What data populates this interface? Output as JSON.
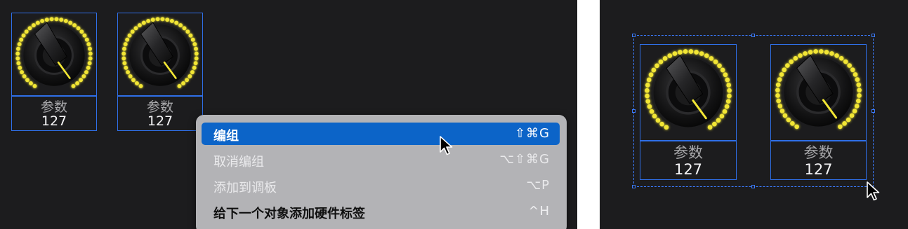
{
  "left_panel": {
    "knobs": [
      {
        "label": "参数",
        "value": "127"
      },
      {
        "label": "参数",
        "value": "127"
      }
    ]
  },
  "context_menu": {
    "items": [
      {
        "label": "编组",
        "shortcut": "⇧⌘G",
        "state": "highlighted"
      },
      {
        "label": "取消编组",
        "shortcut": "⌥⇧⌘G",
        "state": "disabled"
      },
      {
        "label": "添加到调板",
        "shortcut": "⌥P",
        "state": "disabled"
      },
      {
        "label": "给下一个对象添加硬件标签",
        "shortcut": "^H",
        "state": "enabled"
      }
    ]
  },
  "right_panel": {
    "knobs": [
      {
        "label": "参数",
        "value": "127"
      },
      {
        "label": "参数",
        "value": "127"
      }
    ]
  },
  "colors": {
    "background": "#1c1c1e",
    "led": "#f2e634",
    "selection": "#2f6fe8",
    "menu_background": "#b3b3b6",
    "menu_highlight": "#0c64c8"
  },
  "icons": [
    "knob-dial",
    "pointer-cursor",
    "shift-key",
    "command-key",
    "option-key",
    "control-key"
  ]
}
